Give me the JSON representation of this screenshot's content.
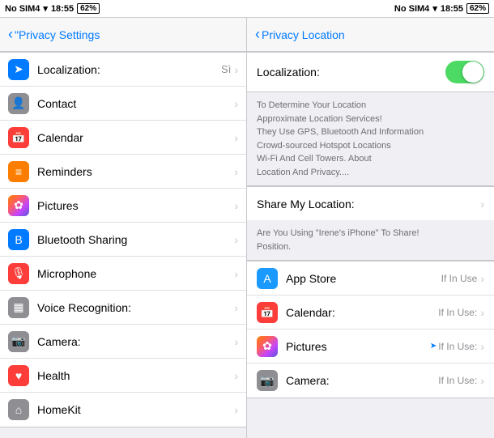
{
  "statusBar": {
    "leftCarrier": "No SIM4",
    "leftSignal": "▲",
    "leftWifi": "◀",
    "leftTime": "18:55",
    "leftBattery": "62%",
    "rightCarrier": "No SIM4",
    "rightSignal": "▲",
    "rightWifi": "◀",
    "rightTime": "18:55",
    "rightBattery": "62%"
  },
  "navLeft": {
    "backLabel": "\"Privacy Settings"
  },
  "navRight": {
    "backLabel": "Privacy Location"
  },
  "leftItems": [
    {
      "id": "localization",
      "label": "Localization:",
      "value": "Sì",
      "icon": "arrow",
      "iconClass": "icon-blue"
    },
    {
      "id": "contact",
      "label": "Contact",
      "value": "",
      "icon": "👤",
      "iconClass": "icon-gray"
    },
    {
      "id": "calendar",
      "label": "Calendar",
      "value": "",
      "icon": "📅",
      "iconClass": "icon-red-calendar"
    },
    {
      "id": "reminders",
      "label": "Reminders",
      "value": "",
      "icon": "≡",
      "iconClass": "icon-list"
    },
    {
      "id": "pictures",
      "label": "Pictures",
      "value": "",
      "icon": "✿",
      "iconClass": "icon-photos"
    },
    {
      "id": "bluetooth",
      "label": "Bluetooth Sharing",
      "value": "",
      "icon": "B",
      "iconClass": "icon-bluetooth"
    },
    {
      "id": "microphone",
      "label": "Microphone",
      "value": "",
      "icon": "🎙",
      "iconClass": "icon-mic"
    },
    {
      "id": "voice",
      "label": "Voice Recognition:",
      "value": "",
      "icon": "▦",
      "iconClass": "icon-grid"
    },
    {
      "id": "camera",
      "label": "Camera:",
      "value": "",
      "icon": "📷",
      "iconClass": "icon-camera"
    },
    {
      "id": "health",
      "label": "Health",
      "value": "",
      "icon": "♥",
      "iconClass": "icon-health"
    },
    {
      "id": "homekit",
      "label": "HomeKit",
      "value": "",
      "icon": "⌂",
      "iconClass": "icon-homekit"
    }
  ],
  "rightPanel": {
    "localizationLabel": "Localization:",
    "locationDescription": "To Determine Your Location\nApproximate Location Services!\nThey Use GPS, Bluetooth And Information\nCrowd-sourced Hotspot Locations\nWi-Fi And Cell Towers. About\nLocation And Privacy....",
    "shareLocationLabel": "Share My Location:",
    "shareDescription": "Are You Using \"Irene's iPhone\" To Share!\nPosition.",
    "appItems": [
      {
        "id": "appstore",
        "label": "App Store",
        "value": "If In Use",
        "icon": "A",
        "iconClass": "icon-appstore",
        "showArrow": false
      },
      {
        "id": "calendar-r",
        "label": "Calendar:",
        "value": "If In Use:",
        "icon": "📅",
        "iconClass": "icon-calendar-r",
        "showArrow": false
      },
      {
        "id": "pictures-r",
        "label": "Pictures",
        "value": "If In Use:",
        "icon": "✿",
        "iconClass": "icon-photos-r",
        "showArrow": true
      },
      {
        "id": "camera-r",
        "label": "Camera:",
        "value": "If In Use:",
        "icon": "📷",
        "iconClass": "icon-camera-r",
        "showArrow": false
      }
    ]
  }
}
